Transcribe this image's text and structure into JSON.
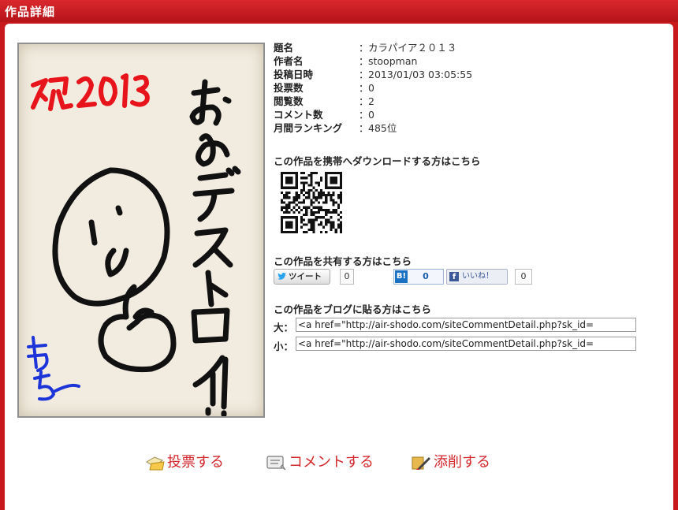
{
  "header": {
    "title": "作品詳細"
  },
  "meta": [
    {
      "label": "題名",
      "value": "カラパイア２０１３"
    },
    {
      "label": "作者名",
      "value": "stoopman"
    },
    {
      "label": "投稿日時",
      "value": "2013/01/03 03:05:55"
    },
    {
      "label": "投票数",
      "value": "0"
    },
    {
      "label": "閲覧数",
      "value": "2"
    },
    {
      "label": "コメント数",
      "value": "0"
    },
    {
      "label": "月間ランキング",
      "value": "485位"
    }
  ],
  "colon": "：",
  "download": {
    "title": "この作品を携帯へダウンロードする方はこちら"
  },
  "share": {
    "title": "この作品を共有する方はこちら",
    "tweet_label": "ツイート",
    "tweet_count": "0",
    "hatena_label": "B!",
    "hatena_count": "0",
    "facebook_label": "いいね！",
    "facebook_count": "0"
  },
  "blog": {
    "title": "この作品をブログに貼る方はこちら",
    "large_label": "大：",
    "large_value": "<a href=\"http://air-shodo.com/siteCommentDetail.php?sk_id=",
    "small_label": "小：",
    "small_value": "<a href=\"http://air-shodo.com/siteCommentDetail.php?sk_id="
  },
  "actions": {
    "vote": "投票する",
    "comment": "コメントする",
    "correct": "添削する"
  },
  "colors": {
    "brand_red": "#c8191e",
    "action_red": "#d4262b"
  },
  "artwork_text": {
    "red_text": "祝2013",
    "main_text": "おめデストロイ！",
    "blue_text": "もちこ"
  }
}
